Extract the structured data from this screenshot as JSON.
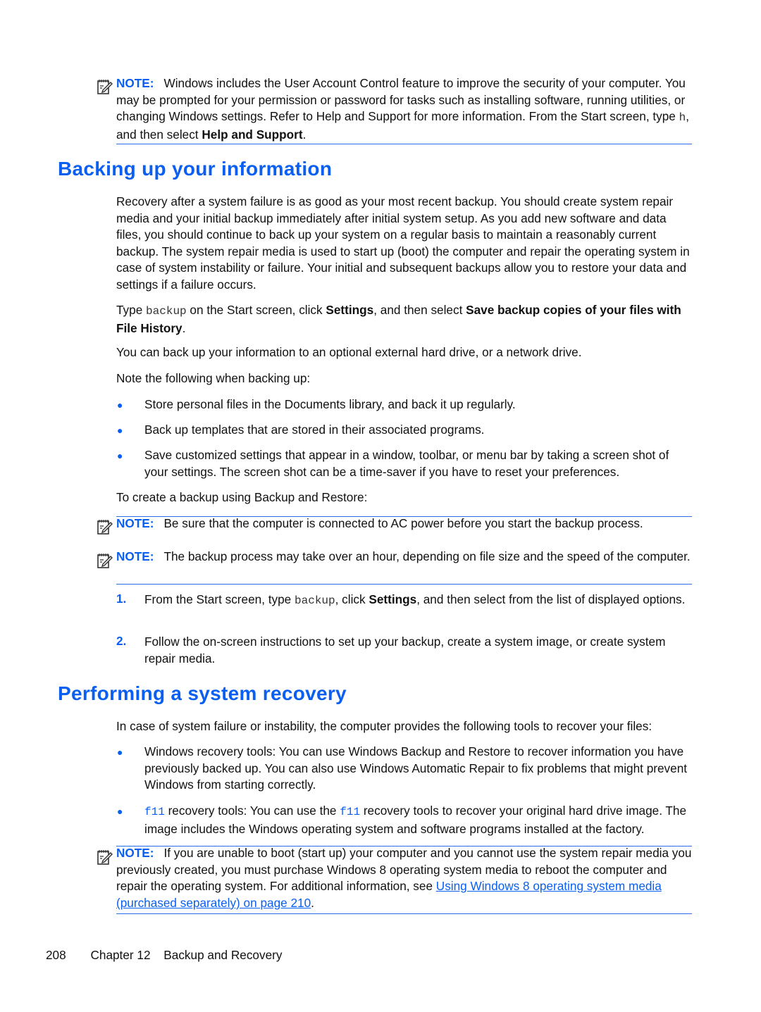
{
  "colors": {
    "accent": "#0a5ff0"
  },
  "note_label": "NOTE:",
  "note1": [
    {
      "t": "Windows includes the User Account Control feature to improve the security of your computer. You may be prompted for your permission or password for tasks such as installing software, running utilities, or changing Windows settings. Refer to Help and Support for more information. From the Start screen, type "
    },
    {
      "t": "h",
      "s": "c"
    },
    {
      "t": ", and then select "
    },
    {
      "t": "Help and Support",
      "s": "b"
    },
    {
      "t": "."
    }
  ],
  "section1": {
    "title": "Backing up your information",
    "p1": [
      {
        "t": "Recovery after a system failure is as good as your most recent backup. You should create system repair media and your initial backup immediately after initial system setup. As you add new software and data files, you should continue to back up your system on a regular basis to maintain a reasonably current backup. The system repair media is used to start up (boot) the computer and repair the operating system in case of system instability or failure. Your initial and subsequent backups allow you to restore your data and settings if a failure occurs."
      }
    ],
    "p2": [
      {
        "t": "Type "
      },
      {
        "t": "backup",
        "s": "c"
      },
      {
        "t": " on the Start screen, click "
      },
      {
        "t": "Settings",
        "s": "b"
      },
      {
        "t": ", and then select "
      },
      {
        "t": "Save backup copies of your files with File History",
        "s": "b"
      },
      {
        "t": "."
      }
    ],
    "p3": [
      {
        "t": "You can back up your information to an optional external hard drive, or a network drive."
      }
    ],
    "p4": [
      {
        "t": "Note the following when backing up:"
      }
    ],
    "bullets": [
      [
        {
          "t": "Store personal files in the Documents library, and back it up regularly."
        }
      ],
      [
        {
          "t": "Back up templates that are stored in their associated programs."
        }
      ],
      [
        {
          "t": "Save customized settings that appear in a window, toolbar, or menu bar by taking a screen shot of your settings. The screen shot can be a time-saver if you have to reset your preferences."
        }
      ]
    ],
    "p5": [
      {
        "t": "To create a backup using Backup and Restore:"
      }
    ],
    "note2": [
      {
        "t": "Be sure that the computer is connected to AC power before you start the backup process."
      }
    ],
    "note3": [
      {
        "t": "The backup process may take over an hour, depending on file size and the speed of the computer."
      }
    ],
    "steps": [
      {
        "n": "1.",
        "text": [
          {
            "t": "From the Start screen, type "
          },
          {
            "t": "backup",
            "s": "c"
          },
          {
            "t": ", click "
          },
          {
            "t": "Settings",
            "s": "b"
          },
          {
            "t": ", and then select from the list of displayed options."
          }
        ]
      },
      {
        "n": "2.",
        "text": [
          {
            "t": "Follow the on-screen instructions to set up your backup, create a system image, or create system repair media."
          }
        ]
      }
    ]
  },
  "section2": {
    "title": "Performing a system recovery",
    "p1": [
      {
        "t": "In case of system failure or instability, the computer provides the following tools to recover your files:"
      }
    ],
    "bullets": [
      [
        {
          "t": "Windows recovery tools: You can use Windows Backup and Restore to recover information you have previously backed up. You can also use Windows Automatic Repair to fix problems that might prevent Windows from starting correctly."
        }
      ],
      [
        {
          "t": "f11",
          "s": "cl"
        },
        {
          "t": " recovery tools: You can use the "
        },
        {
          "t": "f11",
          "s": "cl"
        },
        {
          "t": " recovery tools to recover your original hard drive image. The image includes the Windows operating system and software programs installed at the factory."
        }
      ]
    ],
    "note4": [
      {
        "t": "If you are unable to boot (start up) your computer and you cannot use the system repair media you previously created, you must purchase Windows 8 operating system media to reboot the computer and repair the operating system. For additional information, see "
      },
      {
        "t": "Using Windows 8 operating system media (purchased separately) on page 210",
        "s": "l"
      },
      {
        "t": "."
      }
    ]
  },
  "footer": {
    "page": "208",
    "chapter": "Chapter 12",
    "title": "Backup and Recovery"
  }
}
